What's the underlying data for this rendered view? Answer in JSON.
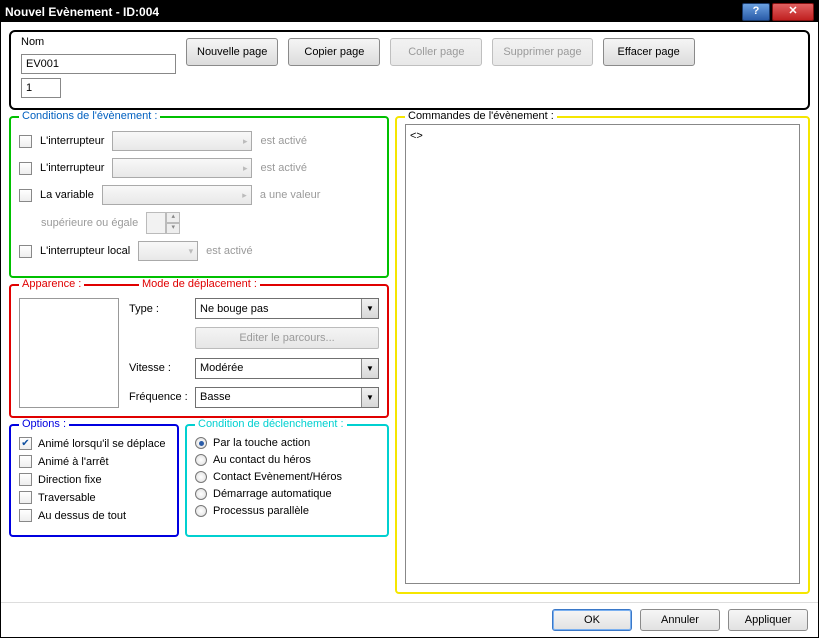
{
  "title": "Nouvel Evènement - ID:004",
  "top": {
    "name_label": "Nom",
    "name_value": "EV001",
    "page_value": "1",
    "buttons": {
      "new": "Nouvelle page",
      "copy": "Copier page",
      "paste": "Coller page",
      "delete": "Supprimer page",
      "clear": "Effacer page"
    }
  },
  "conditions": {
    "legend": "Conditions de l'évènement :",
    "switch1": {
      "label": "L'interrupteur",
      "suffix": "est activé"
    },
    "switch2": {
      "label": "L'interrupteur",
      "suffix": "est activé"
    },
    "variable": {
      "label": "La variable",
      "suffix": "a une valeur",
      "sub": "supérieure ou égale"
    },
    "self_switch": {
      "label": "L'interrupteur local",
      "suffix": "est activé"
    }
  },
  "appearance_legend": "Apparence :",
  "movement": {
    "legend": "Mode de déplacement :",
    "type_label": "Type :",
    "type_value": "Ne bouge pas",
    "edit_route": "Editer le parcours...",
    "speed_label": "Vitesse :",
    "speed_value": "Modérée",
    "freq_label": "Fréquence :",
    "freq_value": "Basse"
  },
  "options": {
    "legend": "Options :",
    "items": [
      {
        "label": "Animé lorsqu'il se déplace",
        "checked": true
      },
      {
        "label": "Animé à l'arrêt",
        "checked": false
      },
      {
        "label": "Direction fixe",
        "checked": false
      },
      {
        "label": "Traversable",
        "checked": false
      },
      {
        "label": "Au dessus de tout",
        "checked": false
      }
    ]
  },
  "trigger": {
    "legend": "Condition de déclenchement :",
    "items": [
      {
        "label": "Par la touche action",
        "selected": true
      },
      {
        "label": "Au contact du héros",
        "selected": false
      },
      {
        "label": "Contact Evènement/Héros",
        "selected": false
      },
      {
        "label": "Démarrage automatique",
        "selected": false
      },
      {
        "label": "Processus parallèle",
        "selected": false
      }
    ]
  },
  "commands": {
    "legend": "Commandes de l'évènement :",
    "content": "<>"
  },
  "footer": {
    "ok": "OK",
    "cancel": "Annuler",
    "apply": "Appliquer"
  }
}
